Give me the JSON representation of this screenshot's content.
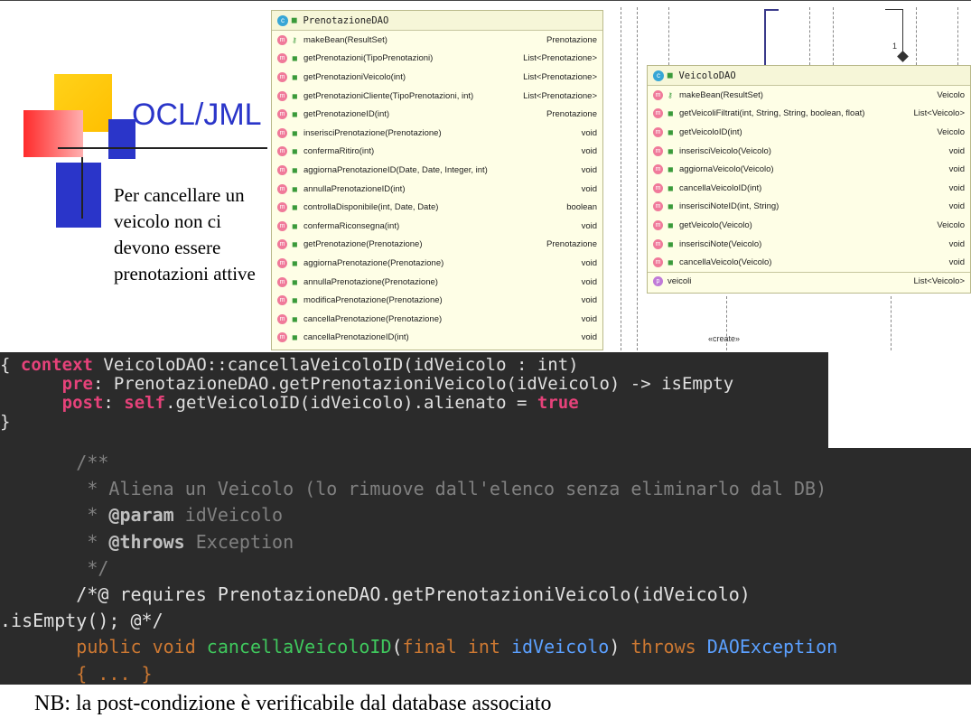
{
  "slide": {
    "title": "OCL/JML",
    "note": "Per cancellare un veicolo non ci devono essere prenotazioni attive",
    "footer": "NB: la post-condizione è verificabile dal database associato"
  },
  "uml_prenotazione": {
    "class_name": "PrenotazioneDAO",
    "methods": [
      {
        "name": "makeBean(ResultSet)",
        "type": "Prenotazione"
      },
      {
        "name": "getPrenotazioni(TipoPrenotazioni)",
        "type": "List<Prenotazione>"
      },
      {
        "name": "getPrenotazioniVeicolo(int)",
        "type": "List<Prenotazione>"
      },
      {
        "name": "getPrenotazioniCliente(TipoPrenotazioni, int)",
        "type": "List<Prenotazione>"
      },
      {
        "name": "getPrenotazioneID(int)",
        "type": "Prenotazione"
      },
      {
        "name": "inserisciPrenotazione(Prenotazione)",
        "type": "void"
      },
      {
        "name": "confermaRitiro(int)",
        "type": "void"
      },
      {
        "name": "aggiornaPrenotazioneID(Date, Date, Integer, int)",
        "type": "void"
      },
      {
        "name": "annullaPrenotazioneID(int)",
        "type": "void"
      },
      {
        "name": "controllaDisponibile(int, Date, Date)",
        "type": "boolean"
      },
      {
        "name": "confermaRiconsegna(int)",
        "type": "void"
      },
      {
        "name": "getPrenotazione(Prenotazione)",
        "type": "Prenotazione"
      },
      {
        "name": "aggiornaPrenotazione(Prenotazione)",
        "type": "void"
      },
      {
        "name": "annullaPrenotazione(Prenotazione)",
        "type": "void"
      },
      {
        "name": "modificaPrenotazione(Prenotazione)",
        "type": "void"
      },
      {
        "name": "cancellaPrenotazione(Prenotazione)",
        "type": "void"
      },
      {
        "name": "cancellaPrenotazioneID(int)",
        "type": "void"
      }
    ]
  },
  "uml_veicolo": {
    "class_name": "VeicoloDAO",
    "methods": [
      {
        "name": "makeBean(ResultSet)",
        "type": "Veicolo"
      },
      {
        "name": "getVeicoliFiltrati(int, String, String, boolean, float)",
        "type": "List<Veicolo>"
      },
      {
        "name": "getVeicoloID(int)",
        "type": "Veicolo"
      },
      {
        "name": "inserisciVeicolo(Veicolo)",
        "type": "void"
      },
      {
        "name": "aggiornaVeicolo(Veicolo)",
        "type": "void"
      },
      {
        "name": "cancellaVeicoloID(int)",
        "type": "void"
      },
      {
        "name": "inserisciNoteID(int, String)",
        "type": "void"
      },
      {
        "name": "getVeicolo(Veicolo)",
        "type": "Veicolo"
      },
      {
        "name": "inserisciNote(Veicolo)",
        "type": "void"
      },
      {
        "name": "cancellaVeicolo(Veicolo)",
        "type": "void"
      }
    ],
    "property": {
      "name": "veicoli",
      "type": "List<Veicolo>"
    }
  },
  "diagram_labels": {
    "create": "«create»",
    "multiplicity": "1"
  },
  "ocl": {
    "line1_brace": "{ ",
    "line1_kw": "context",
    "line1_rest": " VeicoloDAO::cancellaVeicoloID(idVeicolo : int)",
    "pre_kw": "pre",
    "pre_rest": ": PrenotazioneDAO.getPrenotazioniVeicolo(idVeicolo) -> isEmpty",
    "post_kw": "post",
    "post_colon": ": ",
    "post_self": "self",
    "post_mid": ".getVeicoloID(idVeicolo).alienato = ",
    "post_true": "true",
    "close": "}"
  },
  "jml": {
    "c1": "/**",
    "c2": " * Aliena un Veicolo (lo rimuove dall'elenco senza eliminarlo dal DB)",
    "c3_star": " * ",
    "c3_tag": "@param",
    "c3_rest": " idVeicolo",
    "c4_star": " * ",
    "c4_tag": "@throws",
    "c4_rest": " Exception",
    "c5": " */",
    "req1": "/*@ requires PrenotazioneDAO.getPrenotazioniVeicolo(idVeicolo)",
    "req2": ".isEmpty(); @*/",
    "sig_public": "public void ",
    "sig_name": "cancellaVeicoloID",
    "sig_paren": "(",
    "sig_final": "final int ",
    "sig_param": "idVeicolo",
    "sig_close": ") ",
    "sig_throws": "throws ",
    "sig_exc": "DAOException",
    "body": "{ ... }"
  }
}
